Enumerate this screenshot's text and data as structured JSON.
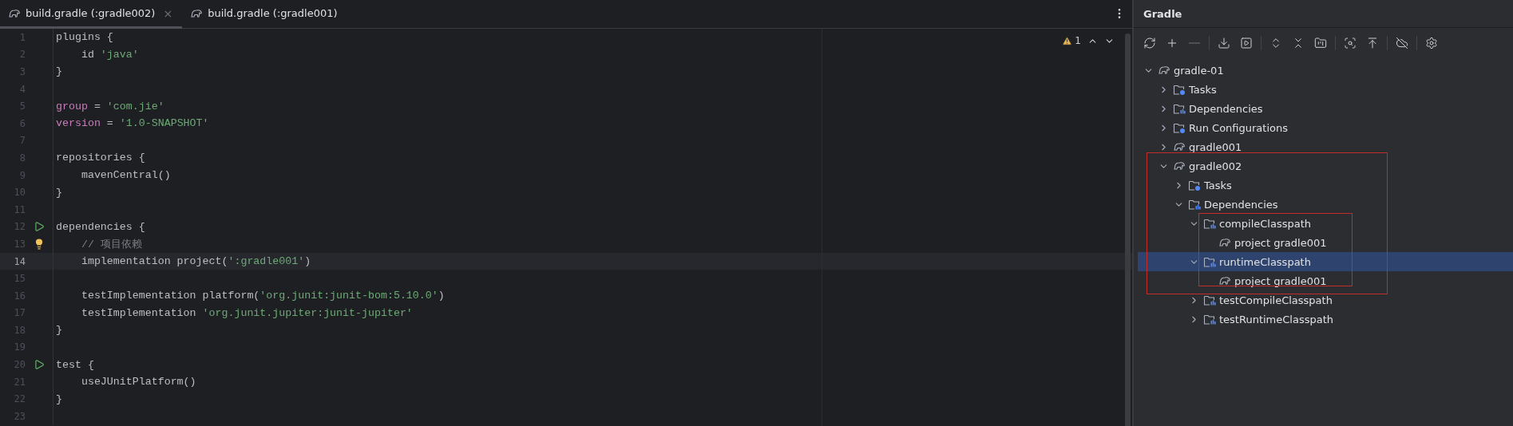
{
  "editor": {
    "tabs": [
      {
        "label": "build.gradle (:gradle002)",
        "selected": true,
        "close": "×"
      },
      {
        "label": "build.gradle (:gradle001)",
        "selected": false
      }
    ],
    "inspection": {
      "warnings": "1"
    },
    "lines": [
      {
        "number": "1",
        "tokens": [
          {
            "kind": "plain",
            "text": "plugins {"
          }
        ]
      },
      {
        "number": "2",
        "tokens": [
          {
            "kind": "plain",
            "text": "    id "
          },
          {
            "kind": "string",
            "text": "'java'"
          }
        ]
      },
      {
        "number": "3",
        "tokens": [
          {
            "kind": "plain",
            "text": "}"
          }
        ]
      },
      {
        "number": "4"
      },
      {
        "number": "5",
        "tokens": [
          {
            "kind": "keyword",
            "text": "group"
          },
          {
            "kind": "plain",
            "text": " = "
          },
          {
            "kind": "string",
            "text": "'com.jie'"
          }
        ]
      },
      {
        "number": "6",
        "tokens": [
          {
            "kind": "keyword",
            "text": "version"
          },
          {
            "kind": "plain",
            "text": " = "
          },
          {
            "kind": "string",
            "text": "'1.0-SNAPSHOT'"
          }
        ]
      },
      {
        "number": "7"
      },
      {
        "number": "8",
        "tokens": [
          {
            "kind": "plain",
            "text": "repositories {"
          }
        ]
      },
      {
        "number": "9",
        "tokens": [
          {
            "kind": "plain",
            "text": "    mavenCentral()"
          }
        ]
      },
      {
        "number": "10",
        "tokens": [
          {
            "kind": "plain",
            "text": "}"
          }
        ]
      },
      {
        "number": "11"
      },
      {
        "number": "12",
        "kind": "run",
        "tokens": [
          {
            "kind": "plain",
            "text": "dependencies {"
          }
        ]
      },
      {
        "number": "13",
        "kind": "bulb",
        "tokens": [
          {
            "kind": "comment",
            "text": "    // 项目依赖"
          }
        ]
      },
      {
        "number": "14",
        "current": true,
        "tokens": [
          {
            "kind": "plain",
            "text": "    implementation project("
          },
          {
            "kind": "string",
            "text": "':gradle001'"
          },
          {
            "kind": "plain",
            "text": ")"
          }
        ]
      },
      {
        "number": "15"
      },
      {
        "number": "16",
        "tokens": [
          {
            "kind": "plain",
            "text": "    testImplementation platform("
          },
          {
            "kind": "string",
            "text": "'org.junit:junit-bom:5.10.0'"
          },
          {
            "kind": "plain",
            "text": ")"
          }
        ]
      },
      {
        "number": "17",
        "tokens": [
          {
            "kind": "plain",
            "text": "    testImplementation "
          },
          {
            "kind": "string",
            "text": "'org.junit.jupiter:junit-jupiter'"
          }
        ]
      },
      {
        "number": "18",
        "tokens": [
          {
            "kind": "plain",
            "text": "}"
          }
        ]
      },
      {
        "number": "19"
      },
      {
        "number": "20",
        "kind": "run",
        "tokens": [
          {
            "kind": "plain",
            "text": "test {"
          }
        ]
      },
      {
        "number": "21",
        "tokens": [
          {
            "kind": "plain",
            "text": "    useJUnitPlatform()"
          }
        ]
      },
      {
        "number": "22",
        "tokens": [
          {
            "kind": "plain",
            "text": "}"
          }
        ]
      },
      {
        "number": "23"
      }
    ]
  },
  "gradle_panel": {
    "title": "Gradle",
    "toolbar": [
      {
        "kind": "refresh",
        "disabled": false
      },
      {
        "kind": "add",
        "disabled": false
      },
      {
        "kind": "remove",
        "disabled": true
      },
      {
        "kind": "separator"
      },
      {
        "kind": "download",
        "disabled": false
      },
      {
        "kind": "run",
        "disabled": false
      },
      {
        "kind": "separator"
      },
      {
        "kind": "expand",
        "disabled": false
      },
      {
        "kind": "collapse",
        "disabled": false
      },
      {
        "kind": "group",
        "disabled": false
      },
      {
        "kind": "separator"
      },
      {
        "kind": "analyze",
        "disabled": false
      },
      {
        "kind": "align",
        "disabled": false
      },
      {
        "kind": "separator"
      },
      {
        "kind": "offline",
        "disabled": false
      },
      {
        "kind": "separator"
      },
      {
        "kind": "settings",
        "disabled": false
      }
    ],
    "tree": [
      {
        "label": "gradle-01",
        "kind": "project",
        "expanded": true,
        "selected": false,
        "children": [
          {
            "label": "Tasks",
            "kind": "tasks",
            "expanded": false,
            "selected": false
          },
          {
            "label": "Dependencies",
            "kind": "deps",
            "expanded": false,
            "selected": false
          },
          {
            "label": "Run Configurations",
            "kind": "tasks",
            "expanded": false,
            "selected": false
          },
          {
            "label": "gradle001",
            "kind": "project",
            "expanded": false,
            "selected": false
          },
          {
            "label": "gradle002",
            "kind": "project",
            "expanded": true,
            "selected": false,
            "children": [
              {
                "label": "Tasks",
                "kind": "tasks",
                "expanded": false,
                "selected": false
              },
              {
                "label": "Dependencies",
                "kind": "deps",
                "expanded": true,
                "selected": false,
                "children": [
                  {
                    "label": "compileClasspath",
                    "kind": "deps",
                    "expanded": true,
                    "selected": false,
                    "children": [
                      {
                        "label": "project gradle001",
                        "kind": "project",
                        "selected": false
                      }
                    ]
                  },
                  {
                    "label": "runtimeClasspath",
                    "kind": "deps",
                    "expanded": true,
                    "selected": true,
                    "children": [
                      {
                        "label": "project gradle001",
                        "kind": "project",
                        "selected": false
                      }
                    ]
                  },
                  {
                    "label": "testCompileClasspath",
                    "kind": "deps",
                    "expanded": false,
                    "selected": false
                  },
                  {
                    "label": "testRuntimeClasspath",
                    "kind": "deps",
                    "expanded": false,
                    "selected": false
                  }
                ]
              }
            ]
          }
        ]
      }
    ]
  }
}
